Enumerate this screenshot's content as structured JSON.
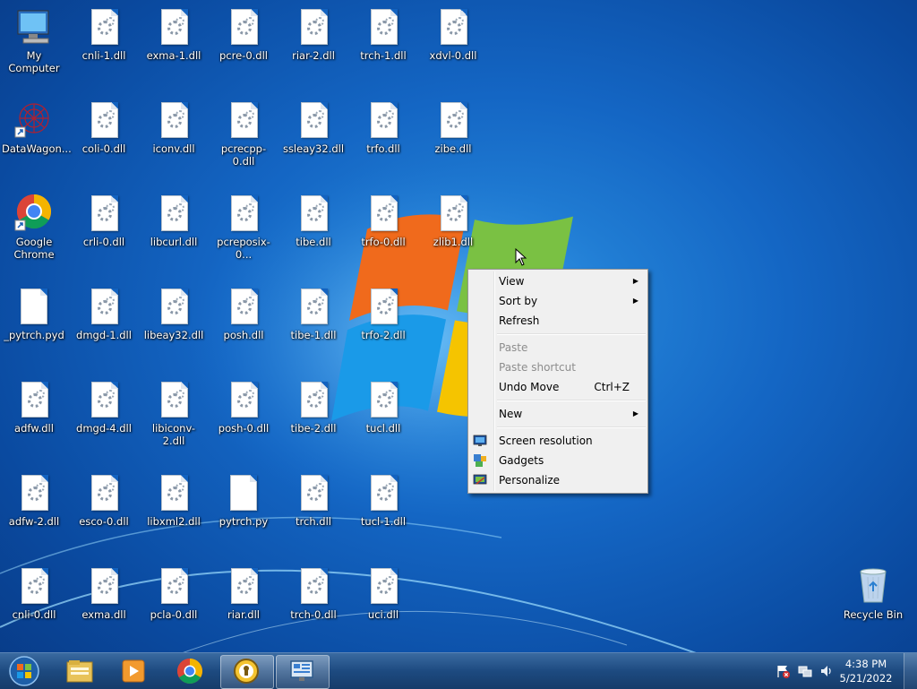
{
  "desktop": {
    "icons": [
      {
        "label": "My Computer"
      },
      {
        "label": "cnli-1.dll"
      },
      {
        "label": "exma-1.dll"
      },
      {
        "label": "pcre-0.dll"
      },
      {
        "label": "riar-2.dll"
      },
      {
        "label": "trch-1.dll"
      },
      {
        "label": "xdvl-0.dll"
      },
      {
        "label": "DataWagon..."
      },
      {
        "label": "coli-0.dll"
      },
      {
        "label": "iconv.dll"
      },
      {
        "label": "pcrecpp-0.dll"
      },
      {
        "label": "ssleay32.dll"
      },
      {
        "label": "trfo.dll"
      },
      {
        "label": "zibe.dll"
      },
      {
        "label": "Google Chrome"
      },
      {
        "label": "crli-0.dll"
      },
      {
        "label": "libcurl.dll"
      },
      {
        "label": "pcreposix-0..."
      },
      {
        "label": "tibe.dll"
      },
      {
        "label": "trfo-0.dll"
      },
      {
        "label": "zlib1.dll"
      },
      {
        "label": "_pytrch.pyd"
      },
      {
        "label": "dmgd-1.dll"
      },
      {
        "label": "libeay32.dll"
      },
      {
        "label": "posh.dll"
      },
      {
        "label": "tibe-1.dll"
      },
      {
        "label": "trfo-2.dll"
      },
      {
        "label": "adfw.dll"
      },
      {
        "label": "dmgd-4.dll"
      },
      {
        "label": "libiconv-2.dll"
      },
      {
        "label": "posh-0.dll"
      },
      {
        "label": "tibe-2.dll"
      },
      {
        "label": "tucl.dll"
      },
      {
        "label": "adfw-2.dll"
      },
      {
        "label": "esco-0.dll"
      },
      {
        "label": "libxml2.dll"
      },
      {
        "label": "pytrch.py"
      },
      {
        "label": "trch.dll"
      },
      {
        "label": "tucl-1.dll"
      },
      {
        "label": "cnli-0.dll"
      },
      {
        "label": "exma.dll"
      },
      {
        "label": "pcla-0.dll"
      },
      {
        "label": "riar.dll"
      },
      {
        "label": "trch-0.dll"
      },
      {
        "label": "uci.dll"
      },
      {
        "label": "Recycle Bin"
      }
    ]
  },
  "context_menu": {
    "view": "View",
    "sort_by": "Sort by",
    "refresh": "Refresh",
    "paste": "Paste",
    "paste_shortcut": "Paste shortcut",
    "undo_move": "Undo Move",
    "undo_shortcut": "Ctrl+Z",
    "new": "New",
    "screen_resolution": "Screen resolution",
    "gadgets": "Gadgets",
    "personalize": "Personalize"
  },
  "taskbar": {
    "pinned": [
      "start-orb",
      "windows-explorer-icon",
      "media-player-icon",
      "chrome-icon",
      "security-app-icon",
      "remote-desktop-icon"
    ],
    "active_item": "remote-desktop-icon",
    "clock_time": "4:38 PM",
    "clock_date": "5/21/2022"
  },
  "colors": {
    "desktop_blue": "#1466c4",
    "taskbar": "#1d4a80",
    "menu_bg": "#f0f0f0"
  }
}
